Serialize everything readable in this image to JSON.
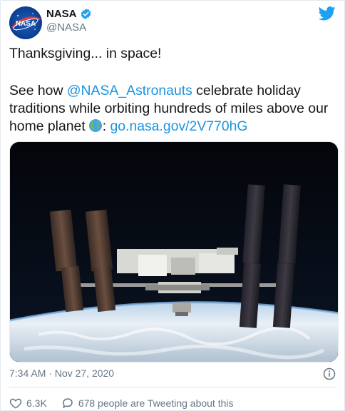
{
  "tweet": {
    "author_name": "NASA",
    "author_handle": "@NASA",
    "line1": "Thanksgiving... in space!",
    "line2_prefix": "See how ",
    "mention": "@NASA_Astronauts",
    "line2_suffix": " celebrate holiday traditions while orbiting hundreds of miles above our home planet",
    "colon": ": ",
    "link": "go.nasa.gov/2V770hG",
    "timestamp": "7:34 AM · Nov 27, 2020",
    "likes": "6.3K",
    "discussion": "678 people are Tweeting about this",
    "avatar_text": "NASA"
  },
  "colors": {
    "link": "#1b95e0",
    "twitter_blue": "#1da1f2",
    "meta_gray": "#657786"
  },
  "icons": [
    "verified-badge-icon",
    "twitter-bird-icon",
    "globe-icon",
    "info-icon",
    "heart-icon",
    "comment-icon"
  ]
}
